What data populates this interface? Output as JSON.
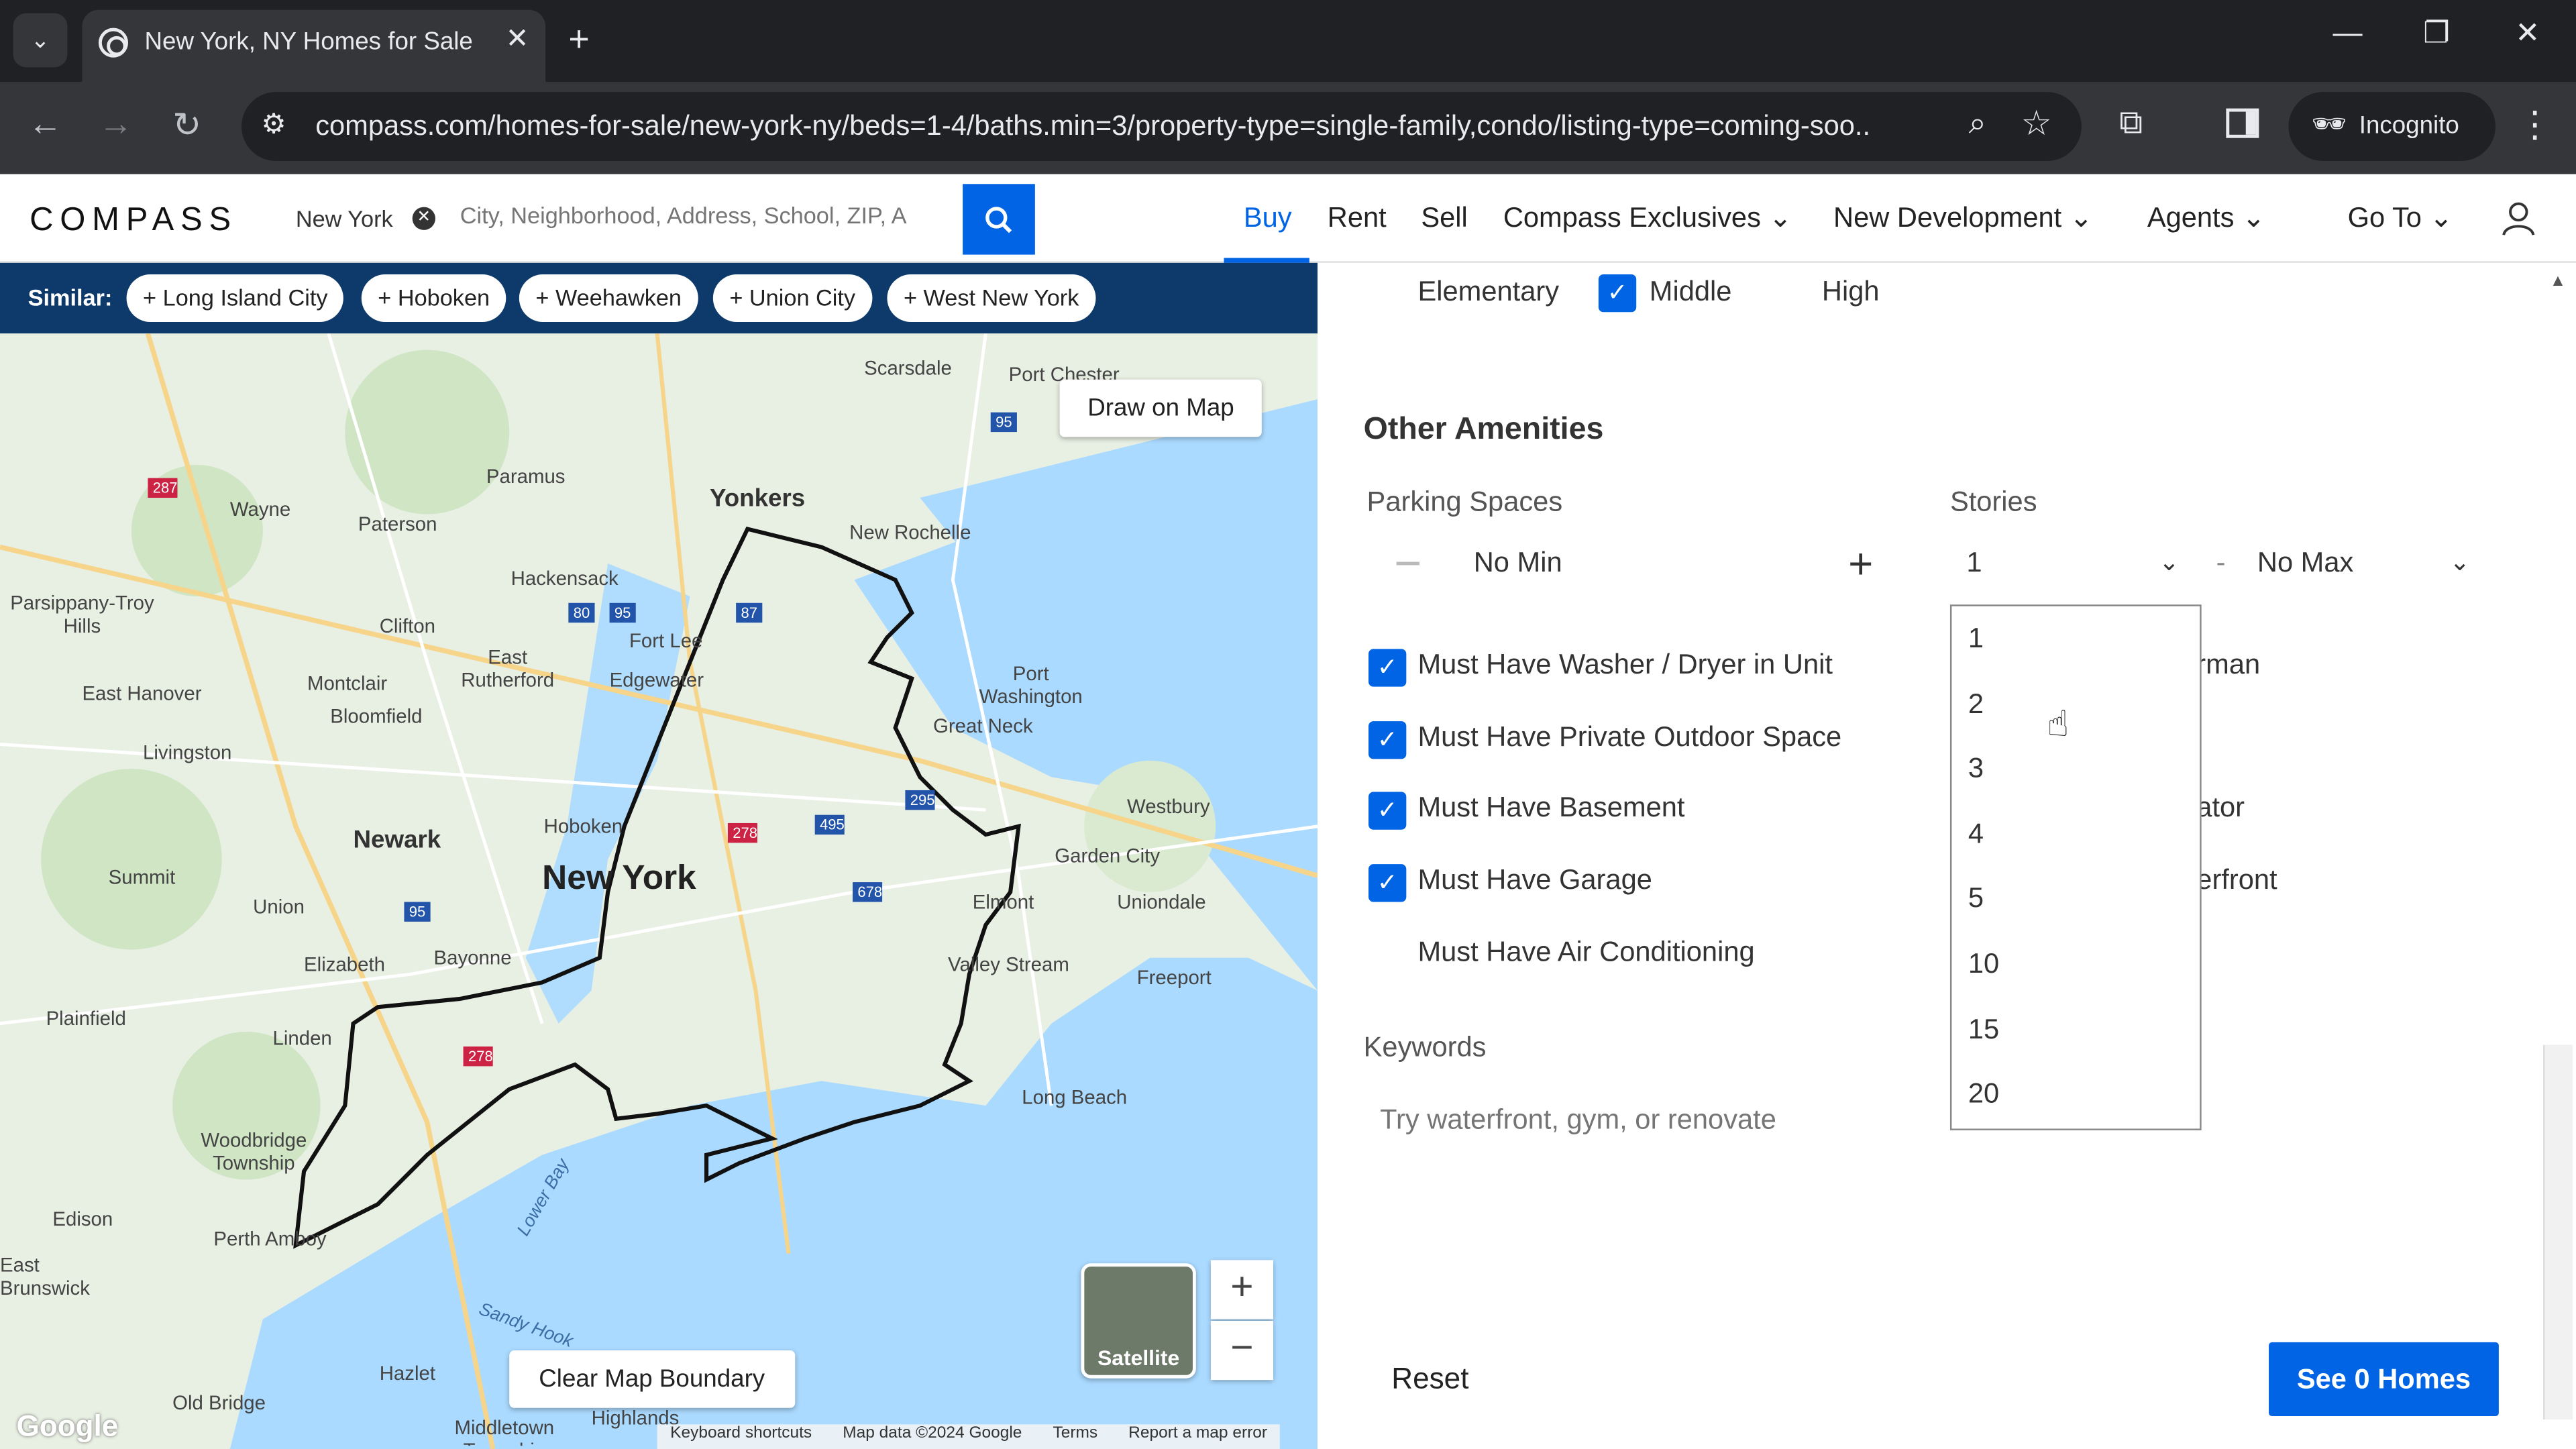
{
  "browser": {
    "tab_title": "New York, NY Homes for Sale -",
    "tab_close": "✕",
    "new_tab": "+",
    "url": "compass.com/homes-for-sale/new-york-ny/beds=1-4/baths.min=3/property-type=single-family,condo/listing-type=coming-soo...",
    "incognito_label": "Incognito",
    "icons": [
      "tab-list-icon",
      "back-icon",
      "forward-icon",
      "reload-icon",
      "site-settings-icon",
      "zoom-icon",
      "bookmark-star-icon",
      "extensions-icon",
      "side-panel-icon",
      "incognito-icon",
      "menu-icon"
    ]
  },
  "header": {
    "logo": "COMPASS",
    "location_chip": "New York",
    "search_placeholder": "City, Neighborhood, Address, School, ZIP, A",
    "nav": {
      "buy": "Buy",
      "rent": "Rent",
      "sell": "Sell",
      "compass_exclusives": "Compass Exclusives",
      "new_development": "New Development",
      "agents": "Agents",
      "go_to": "Go To"
    },
    "accent": "#0064e5"
  },
  "similar": {
    "label": "Similar:",
    "chips": [
      "Long Island City",
      "Hoboken",
      "Weehawken",
      "Union City",
      "West New York"
    ]
  },
  "map": {
    "draw_on_map": "Draw on Map",
    "clear_boundary": "Clear Map Boundary",
    "satellite": "Satellite",
    "zoom_in": "+",
    "zoom_out": "−",
    "google": "Google",
    "footer": [
      "Keyboard shortcuts",
      "Map data ©2024 Google",
      "Terms",
      "Report a map error"
    ],
    "labels": {
      "new_york": "New York",
      "yonkers": "Yonkers",
      "newark": "Newark",
      "new_rochelle": "New Rochelle",
      "scarsdale": "Scarsdale",
      "port_chester": "Port Chester",
      "paramus": "Paramus",
      "wayne": "Wayne",
      "paterson": "Paterson",
      "hackensack": "Hackensack",
      "parsippany": "Parsippany-Troy Hills",
      "clifton": "Clifton",
      "fort_lee": "Fort Lee",
      "east_rutherford": "East Rutherford",
      "edgewater": "Edgewater",
      "montclair": "Montclair",
      "east_hanover": "East Hanover",
      "bloomfield": "Bloomfield",
      "port_washington": "Port Washington",
      "great_neck": "Great Neck",
      "livingston": "Livingston",
      "hoboken": "Hoboken",
      "westbury": "Westbury",
      "garden_city": "Garden City",
      "summit": "Summit",
      "union": "Union",
      "uniondale": "Uniondale",
      "elmont": "Elmont",
      "elizabeth": "Elizabeth",
      "bayonne": "Bayonne",
      "valley_stream": "Valley Stream",
      "freeport": "Freeport",
      "plainfield": "Plainfield",
      "linden": "Linden",
      "long_beach": "Long Beach",
      "woodbridge": "Woodbridge Township",
      "edison": "Edison",
      "perth_amboy": "Perth Amboy",
      "east_brunswick": "East Brunswick",
      "old_bridge": "Old Bridge",
      "hazlet": "Hazlet",
      "highlands": "Highlands",
      "middletown": "Middletown Township",
      "lower_bay": "Lower Bay",
      "sandy_hook": "Sandy Hook"
    }
  },
  "filters": {
    "school_levels": [
      "Elementary",
      "Middle",
      "High"
    ],
    "other_amenities_title": "Other Amenities",
    "parking_spaces_label": "Parking Spaces",
    "parking_min": "No Min",
    "stories_label": "Stories",
    "stories_min": "1",
    "stories_dash": "-",
    "stories_max": "No Max",
    "stories_options": [
      "1",
      "2",
      "3",
      "4",
      "5",
      "10",
      "15",
      "20"
    ],
    "must_haves": [
      {
        "label": "Must Have Washer / Dryer in Unit",
        "checked": true
      },
      {
        "label": "Must Have Private Outdoor Space",
        "checked": true
      },
      {
        "label": "Must Have Basement",
        "checked": true
      },
      {
        "label": "Must Have Garage",
        "checked": true
      },
      {
        "label": "Must Have Air Conditioning",
        "checked": false
      }
    ],
    "partial_right": [
      "rman",
      "ator",
      "erfront"
    ],
    "keywords_label": "Keywords",
    "keywords_placeholder": "Try waterfront, gym, or renovate",
    "reset": "Reset",
    "see_button": "See 0 Homes"
  }
}
